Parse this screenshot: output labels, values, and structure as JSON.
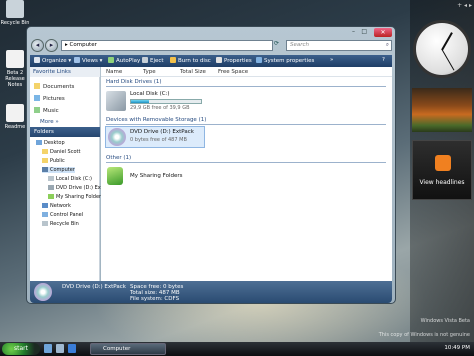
{
  "colors": {
    "accent": "#264b80",
    "toolbar": "#2b4c76",
    "taskbar": "#15191e",
    "progress": "#1c8fc2"
  },
  "desktop": {
    "icons": [
      {
        "label": "Recycle Bin",
        "icon": "recycle-bin-icon"
      },
      {
        "label": "Beta 2 Release Notes",
        "icon": "document-icon"
      },
      {
        "label": "Readme",
        "icon": "document-icon"
      }
    ]
  },
  "window": {
    "address": {
      "path": "Computer",
      "separator": "▸"
    },
    "search": {
      "placeholder": "Search"
    },
    "controls": {
      "minimize": "–",
      "maximize": "□",
      "close": "✕"
    },
    "toolbar": [
      {
        "label": "Organize ▾",
        "icon": "organize-icon"
      },
      {
        "label": "Views ▾",
        "icon": "views-icon"
      },
      {
        "label": "AutoPlay",
        "icon": "autoplay-icon"
      },
      {
        "label": "Eject",
        "icon": "eject-icon"
      },
      {
        "label": "Burn to disc",
        "icon": "burn-icon"
      },
      {
        "label": "Properties",
        "icon": "properties-icon"
      },
      {
        "label": "System properties",
        "icon": "system-properties-icon"
      },
      {
        "label": "»",
        "icon": "more-icon"
      },
      {
        "label": "?",
        "icon": "help-icon"
      }
    ],
    "favorites": {
      "title": "Favorite Links",
      "items": [
        "Documents",
        "Pictures",
        "Music"
      ],
      "more": "More »"
    },
    "folders": {
      "title": "Folders",
      "tree": [
        "Desktop",
        "Daniel Scott",
        "Public",
        "Computer",
        "Local Disk (C:)",
        "DVD Drive (D:) Ext",
        "My Sharing Folder",
        "Network",
        "Control Panel",
        "Recycle Bin"
      ]
    },
    "columns": [
      "Name",
      "Type",
      "Total Size",
      "Free Space"
    ],
    "groups": [
      {
        "title": "Hard Disk Drives (1)"
      },
      {
        "title": "Devices with Removable Storage (1)"
      },
      {
        "title": "Other (1)"
      }
    ],
    "items": {
      "local_disk": {
        "label": "Local Disk (C:)",
        "sub": "29,9 GB free of 39,9 GB",
        "used_fraction": 0.25
      },
      "dvd_drive": {
        "label": "DVD Drive (D:) ExtPack",
        "sub": "0 bytes free of 487 MB"
      },
      "sharing": {
        "label": "My Sharing Folders"
      }
    },
    "details": {
      "name": "DVD Drive (D:) ExtPack",
      "space_free": "Space free: 0 bytes",
      "total_size": "Total size: 487 MB",
      "file_system": "File system: CDFS"
    }
  },
  "sidebar": {
    "top": "+ ◂ ▸",
    "feeds_label": "View headlines"
  },
  "taskbar": {
    "start": "start",
    "task": "Computer",
    "time": "10:49 PM"
  },
  "watermark": {
    "line1": "Windows Vista Beta",
    "line2": "This copy of Windows is not genuine"
  }
}
